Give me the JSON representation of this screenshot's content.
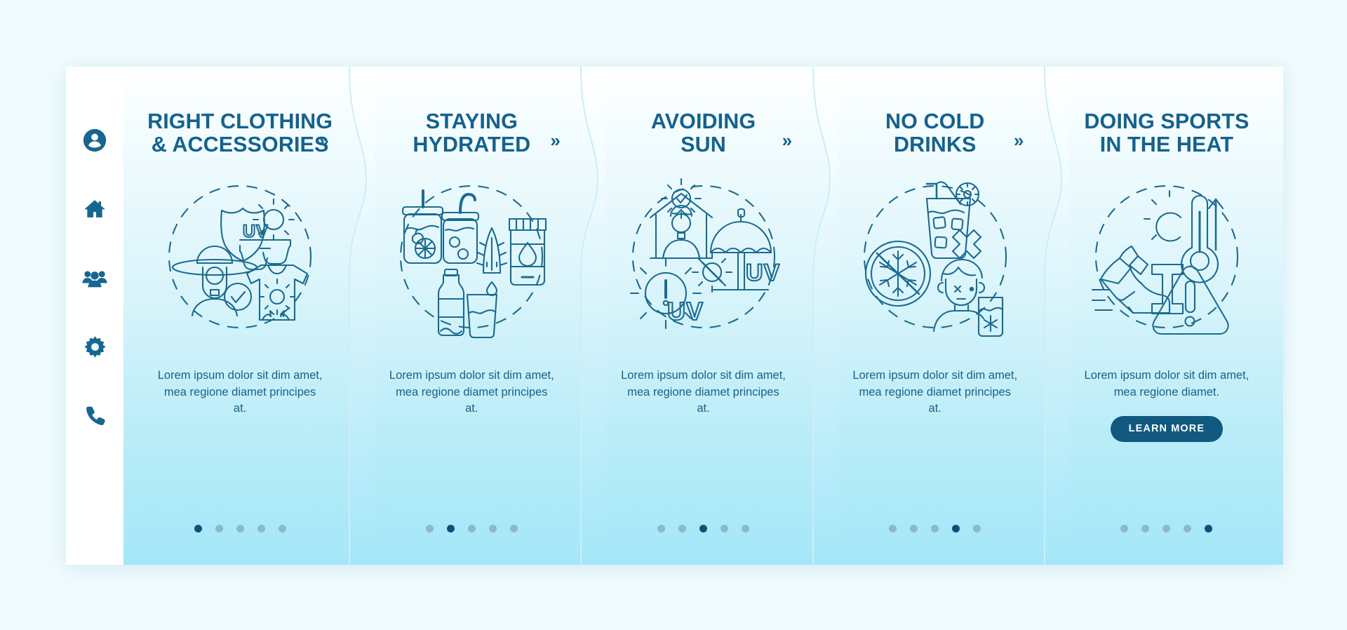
{
  "theme": {
    "page_background": "#f0fbfd",
    "sidebar_background": "#ffffff",
    "accent": "#15628c",
    "accent_dark": "#0d5179",
    "button_background": "#11597f",
    "button_text": "#ffffff",
    "dot_inactive": "#8fb8c6",
    "card_gradient_top": "#ffffff",
    "card_gradient_bottom": "#a4e7f9",
    "text_body": "#1a6185",
    "line_art": "#1b6b8f"
  },
  "sidebar": {
    "items": [
      {
        "icon": "user-circle-icon",
        "name": "profile"
      },
      {
        "icon": "home-icon",
        "name": "home"
      },
      {
        "icon": "group-icon",
        "name": "team"
      },
      {
        "icon": "gear-icon",
        "name": "settings"
      },
      {
        "icon": "phone-icon",
        "name": "contact"
      }
    ]
  },
  "separator": {
    "chevron": "»"
  },
  "cards": [
    {
      "title": "RIGHT CLOTHING\n& ACCESSORIES",
      "title_line1": "RIGHT CLOTHING",
      "title_line2": "& ACCESSORIES",
      "illustration": "sun-protective-clothing-illustration",
      "body": "Lorem ipsum dolor sit dim amet, mea regione diamet principes at.",
      "has_button": false,
      "button_label": "",
      "dots": {
        "count": 5,
        "active_index": 0
      }
    },
    {
      "title": "STAYING\nHYDRATED",
      "title_line1": "STAYING",
      "title_line2": "HYDRATED",
      "illustration": "drinks-hydration-illustration",
      "body": "Lorem ipsum dolor sit dim amet, mea regione diamet principes at.",
      "has_button": false,
      "button_label": "",
      "dots": {
        "count": 5,
        "active_index": 1
      }
    },
    {
      "title": "AVOIDING\nSUN",
      "title_line1": "AVOIDING",
      "title_line2": "SUN",
      "illustration": "avoid-uv-sun-illustration",
      "body": "Lorem ipsum dolor sit dim amet, mea regione diamet principes at.",
      "has_button": false,
      "button_label": "",
      "dots": {
        "count": 5,
        "active_index": 2
      }
    },
    {
      "title": "NO COLD\nDRINKS",
      "title_line1": "NO COLD",
      "title_line2": "DRINKS",
      "illustration": "no-cold-drinks-illustration",
      "body": "Lorem ipsum dolor sit dim amet, mea regione diamet principes at.",
      "has_button": false,
      "button_label": "",
      "dots": {
        "count": 5,
        "active_index": 3
      }
    },
    {
      "title": "DOING SPORTS\nIN THE HEAT",
      "title_line1": "DOING SPORTS",
      "title_line2": "IN THE HEAT",
      "illustration": "sports-in-heat-illustration",
      "body": "Lorem ipsum dolor sit dim amet, mea regione diamet.",
      "has_button": true,
      "button_label": "LEARN MORE",
      "dots": {
        "count": 5,
        "active_index": 4
      }
    }
  ]
}
